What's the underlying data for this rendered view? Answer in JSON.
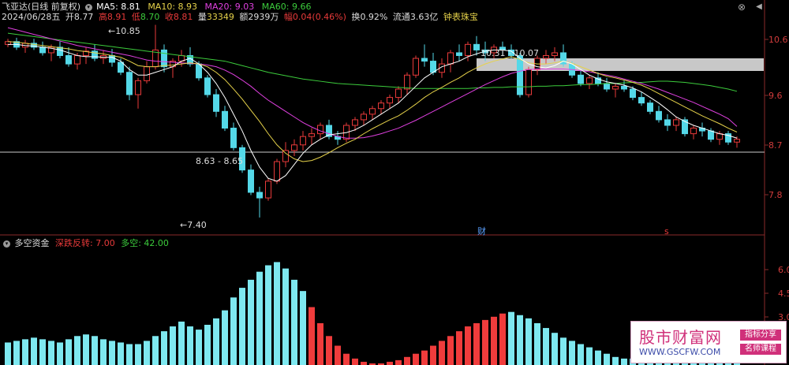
{
  "header": {
    "title": "飞亚达(日线 前复权)",
    "ma5": "MA5: 8.81",
    "ma10": "MA10: 8.93",
    "ma20": "MA20: 9.03",
    "ma60": "MA60: 9.66"
  },
  "quote": {
    "date": "2024/06/28五",
    "open_label": "开",
    "open": "8.77",
    "high_label": "高",
    "high": "8.91",
    "low_label": "低",
    "low": "8.70",
    "close_label": "收",
    "close": "8.81",
    "vol_label": "量",
    "vol": "33349",
    "amt_label": "额",
    "amt": "2939万",
    "chg_label": "幅",
    "chg": "0.04(0.46%)",
    "turn_label": "换",
    "turn": "0.92%",
    "float_label": "流通",
    "float": "3.63亿",
    "tag": "钟表珠宝"
  },
  "price_axis": [
    "10.6",
    "9.6",
    "8.7",
    "7.8"
  ],
  "annotations": {
    "high": "10.85",
    "low": "7.40",
    "mid": "8.63 - 8.65",
    "range": "10.31 - 10.07",
    "fin_marker": "财",
    "s_marker": "s"
  },
  "indicator": {
    "title": "多空资金",
    "label1": "深跌反转: 7.00",
    "label2": "多空: 42.00",
    "axis": [
      "6.0",
      "4.5",
      "3.0"
    ]
  },
  "watermark": {
    "title": "股市财富网",
    "url": "WWW.GSCFW.COM",
    "tag1": "指标分享",
    "tag2": "名师课程"
  },
  "colors": {
    "up": "#e83a3a",
    "down": "#54d8e8",
    "ma5": "#ffffff",
    "ma10": "#e6d24a",
    "ma20": "#e040e0",
    "ma60": "#3ccc3c",
    "bar_red": "#f03c3c",
    "bar_cyan": "#7ee8f0"
  },
  "chart_data": {
    "type": "candlestick",
    "ylim": [
      7.2,
      10.9
    ],
    "hist_ylim": [
      0,
      7.5
    ],
    "candles": [
      [
        10.5,
        10.6,
        10.45,
        10.55
      ],
      [
        10.55,
        10.62,
        10.4,
        10.45
      ],
      [
        10.45,
        10.58,
        10.35,
        10.52
      ],
      [
        10.52,
        10.6,
        10.4,
        10.45
      ],
      [
        10.45,
        10.55,
        10.3,
        10.35
      ],
      [
        10.35,
        10.5,
        10.2,
        10.45
      ],
      [
        10.45,
        10.55,
        10.25,
        10.3
      ],
      [
        10.3,
        10.45,
        10.1,
        10.15
      ],
      [
        10.15,
        10.35,
        10.05,
        10.3
      ],
      [
        10.3,
        10.45,
        10.15,
        10.38
      ],
      [
        10.38,
        10.5,
        10.2,
        10.25
      ],
      [
        10.25,
        10.4,
        10.15,
        10.3
      ],
      [
        10.3,
        10.42,
        10.1,
        10.18
      ],
      [
        10.18,
        10.25,
        9.95,
        10.0
      ],
      [
        10.0,
        10.1,
        9.5,
        9.6
      ],
      [
        9.6,
        9.9,
        9.35,
        9.85
      ],
      [
        9.85,
        10.2,
        9.8,
        10.1
      ],
      [
        10.1,
        10.85,
        10.05,
        10.4
      ],
      [
        10.4,
        10.5,
        10.0,
        10.1
      ],
      [
        10.1,
        10.25,
        9.9,
        10.2
      ],
      [
        10.2,
        10.4,
        10.1,
        10.3
      ],
      [
        10.3,
        10.45,
        10.1,
        10.15
      ],
      [
        10.15,
        10.2,
        9.85,
        9.9
      ],
      [
        9.9,
        9.95,
        9.55,
        9.6
      ],
      [
        9.6,
        9.7,
        9.2,
        9.3
      ],
      [
        9.3,
        9.4,
        8.95,
        9.0
      ],
      [
        9.0,
        9.1,
        8.6,
        8.65
      ],
      [
        8.65,
        8.7,
        8.2,
        8.25
      ],
      [
        8.25,
        8.35,
        7.8,
        7.85
      ],
      [
        7.85,
        7.95,
        7.4,
        7.75
      ],
      [
        7.75,
        8.1,
        7.7,
        8.05
      ],
      [
        8.05,
        8.45,
        8.0,
        8.4
      ],
      [
        8.4,
        8.75,
        8.3,
        8.6
      ],
      [
        8.6,
        8.8,
        8.5,
        8.7
      ],
      [
        8.7,
        8.95,
        8.6,
        8.85
      ],
      [
        8.85,
        9.0,
        8.7,
        8.9
      ],
      [
        8.9,
        9.1,
        8.8,
        9.05
      ],
      [
        9.05,
        9.15,
        8.8,
        8.85
      ],
      [
        8.85,
        8.95,
        8.7,
        8.8
      ],
      [
        8.8,
        9.1,
        8.75,
        9.05
      ],
      [
        9.05,
        9.2,
        8.95,
        9.15
      ],
      [
        9.15,
        9.3,
        9.05,
        9.25
      ],
      [
        9.25,
        9.4,
        9.15,
        9.35
      ],
      [
        9.35,
        9.5,
        9.25,
        9.45
      ],
      [
        9.45,
        9.6,
        9.35,
        9.55
      ],
      [
        9.55,
        9.75,
        9.45,
        9.7
      ],
      [
        9.7,
        10.0,
        9.6,
        9.95
      ],
      [
        9.95,
        10.3,
        9.9,
        10.25
      ],
      [
        10.25,
        10.5,
        10.1,
        10.2
      ],
      [
        10.2,
        10.35,
        9.95,
        10.0
      ],
      [
        10.0,
        10.25,
        9.9,
        10.15
      ],
      [
        10.15,
        10.4,
        10.0,
        10.35
      ],
      [
        10.35,
        10.5,
        10.2,
        10.3
      ],
      [
        10.3,
        10.55,
        10.2,
        10.5
      ],
      [
        10.5,
        10.65,
        10.3,
        10.4
      ],
      [
        10.4,
        10.55,
        10.2,
        10.35
      ],
      [
        10.35,
        10.5,
        10.25,
        10.45
      ],
      [
        10.45,
        10.55,
        10.3,
        10.4
      ],
      [
        10.4,
        10.5,
        10.25,
        10.3
      ],
      [
        10.3,
        10.35,
        9.55,
        9.6
      ],
      [
        9.6,
        10.1,
        9.55,
        10.05
      ],
      [
        10.05,
        10.3,
        9.95,
        10.25
      ],
      [
        10.25,
        10.4,
        10.15,
        10.3
      ],
      [
        10.3,
        10.45,
        10.2,
        10.35
      ],
      [
        10.35,
        10.5,
        10.1,
        10.15
      ],
      [
        10.15,
        10.2,
        9.9,
        9.95
      ],
      [
        9.95,
        10.05,
        9.75,
        9.8
      ],
      [
        9.8,
        9.95,
        9.7,
        9.9
      ],
      [
        9.9,
        10.0,
        9.75,
        9.8
      ],
      [
        9.8,
        9.9,
        9.65,
        9.7
      ],
      [
        9.7,
        9.8,
        9.55,
        9.75
      ],
      [
        9.75,
        9.85,
        9.65,
        9.7
      ],
      [
        9.7,
        9.75,
        9.5,
        9.55
      ],
      [
        9.55,
        9.65,
        9.4,
        9.45
      ],
      [
        9.45,
        9.5,
        9.25,
        9.3
      ],
      [
        9.3,
        9.4,
        9.1,
        9.15
      ],
      [
        9.15,
        9.25,
        8.95,
        9.05
      ],
      [
        9.05,
        9.2,
        8.95,
        9.15
      ],
      [
        9.15,
        9.2,
        8.85,
        8.9
      ],
      [
        8.9,
        9.05,
        8.8,
        9.0
      ],
      [
        9.0,
        9.1,
        8.85,
        8.95
      ],
      [
        8.95,
        9.0,
        8.75,
        8.8
      ],
      [
        8.8,
        8.95,
        8.7,
        8.9
      ],
      [
        8.9,
        8.95,
        8.7,
        8.75
      ],
      [
        8.75,
        8.85,
        8.65,
        8.8
      ]
    ],
    "ma5": [
      10.5,
      10.5,
      10.48,
      10.47,
      10.45,
      10.43,
      10.4,
      10.35,
      10.3,
      10.28,
      10.28,
      10.27,
      10.27,
      10.2,
      10.05,
      9.95,
      9.95,
      10.0,
      10.05,
      10.1,
      10.2,
      10.25,
      10.15,
      10.0,
      9.8,
      9.55,
      9.25,
      8.95,
      8.6,
      8.3,
      8.1,
      8.05,
      8.15,
      8.35,
      8.55,
      8.7,
      8.8,
      8.88,
      8.9,
      8.92,
      8.97,
      9.05,
      9.15,
      9.25,
      9.35,
      9.45,
      9.6,
      9.75,
      9.9,
      10.0,
      10.1,
      10.15,
      10.2,
      10.28,
      10.33,
      10.38,
      10.4,
      10.4,
      10.38,
      10.25,
      10.15,
      10.1,
      10.08,
      10.12,
      10.2,
      10.15,
      10.05,
      9.95,
      9.88,
      9.83,
      9.8,
      9.77,
      9.72,
      9.65,
      9.55,
      9.45,
      9.33,
      9.2,
      9.12,
      9.05,
      9.0,
      8.95,
      8.9,
      8.87,
      8.82
    ],
    "ma10": [
      10.55,
      10.54,
      10.52,
      10.5,
      10.48,
      10.46,
      10.44,
      10.42,
      10.39,
      10.37,
      10.35,
      10.33,
      10.3,
      10.27,
      10.2,
      10.12,
      10.1,
      10.1,
      10.12,
      10.13,
      10.15,
      10.17,
      10.15,
      10.1,
      10.0,
      9.87,
      9.7,
      9.52,
      9.32,
      9.12,
      8.9,
      8.7,
      8.55,
      8.45,
      8.4,
      8.42,
      8.48,
      8.56,
      8.65,
      8.73,
      8.8,
      8.9,
      8.99,
      9.07,
      9.15,
      9.22,
      9.32,
      9.43,
      9.55,
      9.65,
      9.73,
      9.82,
      9.9,
      10.0,
      10.08,
      10.15,
      10.2,
      10.24,
      10.28,
      10.23,
      10.17,
      10.15,
      10.15,
      10.17,
      10.2,
      10.16,
      10.1,
      10.04,
      9.98,
      9.93,
      9.9,
      9.86,
      9.82,
      9.77,
      9.7,
      9.62,
      9.54,
      9.46,
      9.38,
      9.3,
      9.22,
      9.15,
      9.08,
      9.0,
      8.93
    ],
    "ma20": [
      10.8,
      10.76,
      10.72,
      10.68,
      10.64,
      10.6,
      10.56,
      10.52,
      10.48,
      10.45,
      10.42,
      10.39,
      10.36,
      10.33,
      10.3,
      10.26,
      10.22,
      10.2,
      10.19,
      10.18,
      10.17,
      10.16,
      10.15,
      10.13,
      10.1,
      10.04,
      9.96,
      9.86,
      9.75,
      9.62,
      9.5,
      9.4,
      9.3,
      9.2,
      9.1,
      9.02,
      8.95,
      8.9,
      8.85,
      8.82,
      8.82,
      8.83,
      8.86,
      8.9,
      8.95,
      9.0,
      9.07,
      9.14,
      9.22,
      9.3,
      9.38,
      9.46,
      9.54,
      9.62,
      9.7,
      9.78,
      9.85,
      9.92,
      9.98,
      10.02,
      10.05,
      10.06,
      10.06,
      10.06,
      10.06,
      10.05,
      10.03,
      10.01,
      9.98,
      9.95,
      9.92,
      9.88,
      9.84,
      9.8,
      9.75,
      9.7,
      9.64,
      9.58,
      9.52,
      9.46,
      9.39,
      9.32,
      9.25,
      9.17,
      9.03
    ],
    "ma60": [
      10.7,
      10.68,
      10.66,
      10.64,
      10.62,
      10.6,
      10.58,
      10.56,
      10.54,
      10.52,
      10.5,
      10.48,
      10.46,
      10.44,
      10.42,
      10.4,
      10.38,
      10.36,
      10.34,
      10.32,
      10.3,
      10.28,
      10.26,
      10.24,
      10.22,
      10.2,
      10.16,
      10.12,
      10.08,
      10.04,
      10.0,
      9.97,
      9.94,
      9.91,
      9.88,
      9.86,
      9.84,
      9.82,
      9.8,
      9.79,
      9.78,
      9.77,
      9.76,
      9.75,
      9.74,
      9.73,
      9.72,
      9.71,
      9.71,
      9.71,
      9.71,
      9.71,
      9.71,
      9.71,
      9.72,
      9.72,
      9.73,
      9.73,
      9.74,
      9.74,
      9.74,
      9.75,
      9.75,
      9.76,
      9.76,
      9.77,
      9.78,
      9.78,
      9.79,
      9.8,
      9.8,
      9.81,
      9.82,
      9.82,
      9.83,
      9.84,
      9.84,
      9.83,
      9.82,
      9.8,
      9.78,
      9.76,
      9.73,
      9.7,
      9.66
    ],
    "hist": [
      [
        1.4,
        "c"
      ],
      [
        1.5,
        "c"
      ],
      [
        1.6,
        "c"
      ],
      [
        1.7,
        "c"
      ],
      [
        1.6,
        "c"
      ],
      [
        1.5,
        "c"
      ],
      [
        1.4,
        "c"
      ],
      [
        1.6,
        "c"
      ],
      [
        1.8,
        "c"
      ],
      [
        1.9,
        "c"
      ],
      [
        1.8,
        "c"
      ],
      [
        1.6,
        "c"
      ],
      [
        1.5,
        "c"
      ],
      [
        1.4,
        "c"
      ],
      [
        1.3,
        "c"
      ],
      [
        1.3,
        "c"
      ],
      [
        1.5,
        "c"
      ],
      [
        1.8,
        "c"
      ],
      [
        2.1,
        "c"
      ],
      [
        2.4,
        "c"
      ],
      [
        2.7,
        "c"
      ],
      [
        2.4,
        "c"
      ],
      [
        2.2,
        "c"
      ],
      [
        2.5,
        "c"
      ],
      [
        2.9,
        "c"
      ],
      [
        3.4,
        "c"
      ],
      [
        4.2,
        "c"
      ],
      [
        4.8,
        "c"
      ],
      [
        5.3,
        "c"
      ],
      [
        5.8,
        "c"
      ],
      [
        6.2,
        "c"
      ],
      [
        6.4,
        "c"
      ],
      [
        6.0,
        "c"
      ],
      [
        5.3,
        "c"
      ],
      [
        4.6,
        "c"
      ],
      [
        3.6,
        "r"
      ],
      [
        2.6,
        "r"
      ],
      [
        1.8,
        "r"
      ],
      [
        1.2,
        "r"
      ],
      [
        0.7,
        "r"
      ],
      [
        0.4,
        "r"
      ],
      [
        0.2,
        "r"
      ],
      [
        0.1,
        "r"
      ],
      [
        0.1,
        "r"
      ],
      [
        0.2,
        "r"
      ],
      [
        0.3,
        "r"
      ],
      [
        0.5,
        "r"
      ],
      [
        0.7,
        "r"
      ],
      [
        0.9,
        "r"
      ],
      [
        1.2,
        "r"
      ],
      [
        1.5,
        "r"
      ],
      [
        1.8,
        "r"
      ],
      [
        2.1,
        "r"
      ],
      [
        2.4,
        "r"
      ],
      [
        2.6,
        "r"
      ],
      [
        2.8,
        "r"
      ],
      [
        3.0,
        "r"
      ],
      [
        3.2,
        "r"
      ],
      [
        3.3,
        "c"
      ],
      [
        3.1,
        "c"
      ],
      [
        2.9,
        "c"
      ],
      [
        2.6,
        "c"
      ],
      [
        2.3,
        "c"
      ],
      [
        2.0,
        "c"
      ],
      [
        1.7,
        "c"
      ],
      [
        1.5,
        "c"
      ],
      [
        1.3,
        "c"
      ],
      [
        1.1,
        "c"
      ],
      [
        0.9,
        "c"
      ],
      [
        0.7,
        "c"
      ],
      [
        0.5,
        "c"
      ],
      [
        0.4,
        "c"
      ],
      [
        0.4,
        "c"
      ],
      [
        0.5,
        "c"
      ],
      [
        0.6,
        "c"
      ],
      [
        0.7,
        "c"
      ],
      [
        0.8,
        "c"
      ],
      [
        0.9,
        "c"
      ],
      [
        1.0,
        "c"
      ],
      [
        1.2,
        "c"
      ],
      [
        1.3,
        "c"
      ],
      [
        1.4,
        "c"
      ],
      [
        1.6,
        "c"
      ],
      [
        1.7,
        "c"
      ],
      [
        1.9,
        "c"
      ]
    ]
  }
}
